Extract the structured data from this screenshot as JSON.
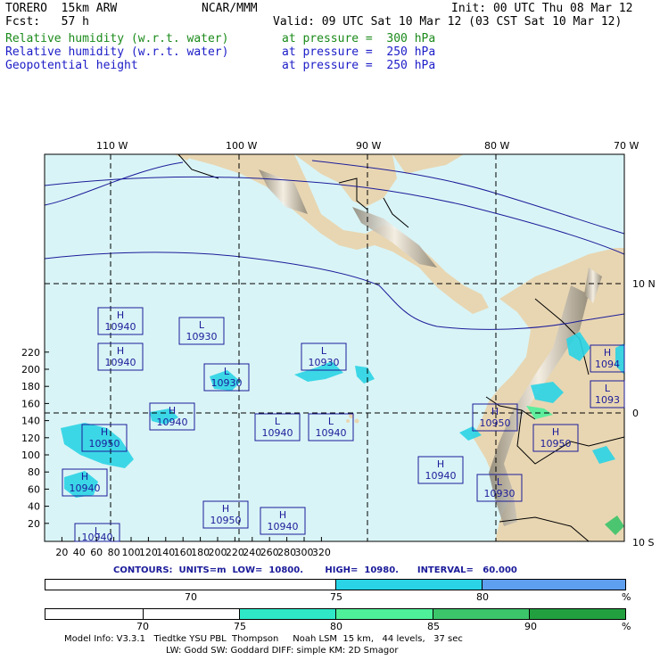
{
  "header": {
    "line1_left": "TORERO  15km ARW",
    "line1_center": "NCAR/MMM",
    "line1_right": "Init: 00 UTC Thu 08 Mar 12",
    "line2_left": "Fcst:   57 h",
    "line2_right": "Valid: 09 UTC Sat 10 Mar 12 (03 CST Sat 10 Mar 12)",
    "fields": [
      {
        "name": "Relative humidity (w.r.t. water)",
        "level": "at pressure =  300 hPa",
        "color": "#1a8a1a"
      },
      {
        "name": "Relative humidity (w.r.t. water)",
        "level": "at pressure =  250 hPa",
        "color": "#1c1cc8"
      },
      {
        "name": "Geopotential height",
        "level": "at pressure =  250 hPa",
        "color": "#1c1cc8"
      }
    ]
  },
  "map": {
    "lon_labels": [
      "110 W",
      "100 W",
      "90 W",
      "80 W",
      "70 W"
    ],
    "lat_labels": [
      "10 N",
      "0",
      "10 S"
    ],
    "y_ticks": [
      "220",
      "200",
      "180",
      "160",
      "140",
      "120",
      "100",
      "80",
      "60",
      "40",
      "20"
    ],
    "x_ticks": [
      "20",
      "40",
      "60",
      "80",
      "100",
      "120",
      "140",
      "160",
      "180",
      "200",
      "220",
      "240",
      "260",
      "280",
      "300",
      "320"
    ],
    "colors": {
      "ocean": "#d9f4f6",
      "land": "#e8d6b2",
      "mountain_dark": "#8a8272",
      "mountain_light": "#f6f2ea",
      "contour": "#1c1c9a",
      "grid": "#000000"
    },
    "pressure_centers": [
      {
        "type": "H",
        "value": "10940"
      },
      {
        "type": "H",
        "value": "10940"
      },
      {
        "type": "L",
        "value": "10930"
      },
      {
        "type": "L",
        "value": "10930"
      },
      {
        "type": "L",
        "value": "10930"
      },
      {
        "type": "H",
        "value": "10940"
      },
      {
        "type": "H",
        "value": "10950"
      },
      {
        "type": "L",
        "value": "10940"
      },
      {
        "type": "L",
        "value": "10940"
      },
      {
        "type": "H",
        "value": "10950"
      },
      {
        "type": "H",
        "value": "10940"
      },
      {
        "type": "L",
        "value": "10940"
      },
      {
        "type": "H",
        "value": "10940"
      },
      {
        "type": "H",
        "value": "10940"
      },
      {
        "type": "H",
        "value": "10950"
      },
      {
        "type": "H",
        "value": "10950"
      },
      {
        "type": "H",
        "value": "1094"
      },
      {
        "type": "L",
        "value": "1093"
      },
      {
        "type": "L",
        "value": "10930"
      }
    ]
  },
  "contour_info": "CONTOURS:  UNITS=m  LOW=  10800.       HIGH=  10980.      INTERVAL=   60.000",
  "colorbar_250": {
    "labels": [
      "70",
      "75",
      "80",
      "%"
    ],
    "colors": [
      "#ffffff",
      "#ffffff",
      "#2ad4e6",
      "#2ad4e6",
      "#5f9ff0"
    ]
  },
  "colorbar_300": {
    "labels": [
      "70",
      "75",
      "80",
      "85",
      "90",
      "%"
    ],
    "colors": [
      "#ffffff",
      "#ffffff",
      "#ffffff",
      "#2ee8c8",
      "#4ef09a",
      "#3cc46a",
      "#22a040"
    ]
  },
  "footer": {
    "line1": "Model Info: V3.3.1   Tiedtke YSU PBL  Thompson     Noah LSM  15 km,   44 levels,   37 sec",
    "line2": "LW: Godd SW: Goddard DIFF: simple KM: 2D Smagor"
  }
}
